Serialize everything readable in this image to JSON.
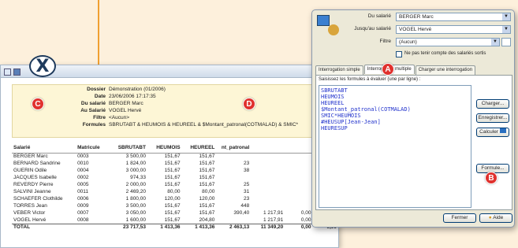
{
  "badges": {
    "a": "A",
    "b": "B",
    "c": "C",
    "d": "D"
  },
  "report": {
    "header": [
      {
        "label": "Dossier",
        "value": "Démonstration (01/2006)"
      },
      {
        "label": "Date",
        "value": "23/06/2006 17:17:35"
      },
      {
        "label": "Du salarié",
        "value": "BERGER Marc"
      },
      {
        "label": "Au Salarié",
        "value": "VOGEL Hervé"
      },
      {
        "label": "Filtre",
        "value": "<Aucun>"
      },
      {
        "label": "Formules",
        "value": "SBRUTABT & HEUMOIS & HEUREEL & $Montant_patronal(COTMALAD) & SMIC*"
      }
    ],
    "columns": [
      "Salarié",
      "Matricule",
      "SBRUTABT",
      "HEUMOIS",
      "HEUREEL",
      "nt_patronal",
      "",
      "",
      ""
    ],
    "rows": [
      [
        "BERGER Marc",
        "0003",
        "3 500,00",
        "151,67",
        "151,67",
        "",
        "",
        "",
        ""
      ],
      [
        "BERNARD Sandrine",
        "0010",
        "1 824,00",
        "151,67",
        "151,67",
        "23",
        "",
        "",
        ""
      ],
      [
        "GUERIN Odile",
        "0004",
        "3 000,00",
        "151,67",
        "151,67",
        "38",
        "",
        "",
        ""
      ],
      [
        "JACQUES Isabelle",
        "0002",
        "974,33",
        "151,67",
        "151,67",
        "",
        "",
        "",
        ""
      ],
      [
        "REVERDY Pierre",
        "0005",
        "2 000,00",
        "151,67",
        "151,67",
        "25",
        "",
        "",
        ""
      ],
      [
        "SALVINI Jeanne",
        "0011",
        "2 469,20",
        "80,00",
        "80,00",
        "31",
        "",
        "",
        ""
      ],
      [
        "SCHAEFER Clothilde",
        "0006",
        "1 800,00",
        "120,00",
        "120,00",
        "23",
        "",
        "",
        ""
      ],
      [
        "TORRES Jean",
        "0009",
        "3 500,00",
        "151,67",
        "151,67",
        "448",
        "",
        "",
        ""
      ],
      [
        "VEBER Victor",
        "0007",
        "3 050,00",
        "151,67",
        "151,67",
        "390,40",
        "1 217,91",
        "0,00",
        "0,00"
      ],
      [
        "VOGEL Hervé",
        "0008",
        "1 600,00",
        "151,67",
        "204,80",
        "",
        "1 217,91",
        "0,00",
        "0,00"
      ]
    ],
    "total": [
      "TOTAL",
      "",
      "23 717,53",
      "1 413,36",
      "1 413,36",
      "2 463,13",
      "11 349,20",
      "0,00",
      "0,00"
    ]
  },
  "dialog": {
    "du_salarie_label": "Du salarié",
    "du_salarie_value": "BERGER Marc",
    "jusqu_label": "Jusqu'au salarié",
    "jusqu_value": "VOGEL Hervé",
    "filtre_label": "Filtre",
    "filtre_value": "(Aucun)",
    "checkbox_label": "Ne pas tenir compte des salariés sortis",
    "tabs": [
      "Interrogation simple",
      "Interrogation multiple",
      "Charger une interrogation"
    ],
    "formula_prompt": "Saisissez les formules à évaluer (une par ligne) :",
    "formulas": [
      "SBRUTABT",
      "HEUMOIS",
      "HEUREEL",
      "$Montant_patronal(COTMALAD)",
      "SMIC*HEUMOIS",
      "#HEUSUP[Jean-Jean]",
      "HEURESUP"
    ],
    "buttons": {
      "charger": "Charger...",
      "enregistrer": "Enregistrer...",
      "calculer": "Calculer",
      "formule": "Formule...",
      "fermer": "Fermer",
      "aide": "Aide"
    }
  }
}
